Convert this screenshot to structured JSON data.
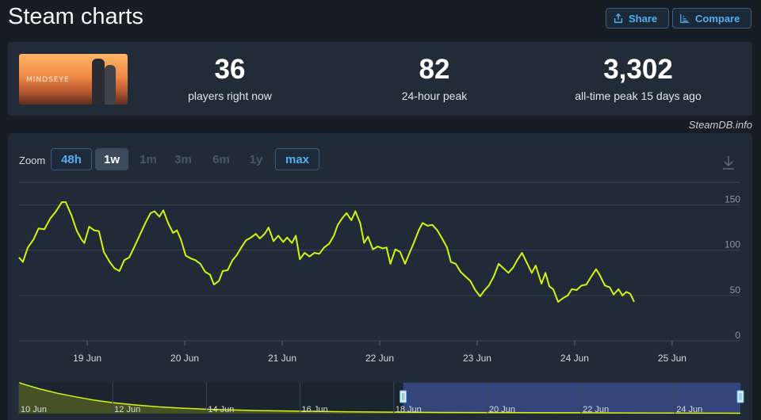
{
  "header": {
    "title": "Steam charts",
    "share_label": "Share",
    "compare_label": "Compare"
  },
  "game": {
    "logo_text": "MINDSEYE"
  },
  "stats": [
    {
      "value": "36",
      "label": "players right now"
    },
    {
      "value": "82",
      "label": "24-hour peak"
    },
    {
      "value": "3,302",
      "label": "all-time peak 15 days ago"
    }
  ],
  "credit": "SteamDB.info",
  "zoom": {
    "label": "Zoom",
    "options": [
      "48h",
      "1w",
      "1m",
      "3m",
      "6m",
      "1y",
      "max"
    ],
    "active": "1w"
  },
  "colors": {
    "line": "#d4f30f",
    "accent": "#4fb0f0",
    "navigator_selection": "#34457c"
  },
  "chart_data": {
    "type": "line",
    "title": "",
    "ylim": [
      0,
      175
    ],
    "yticks": [
      0,
      50,
      100,
      150
    ],
    "xlim": [
      18.3,
      25.7
    ],
    "xtick_labels": [
      "19 Jun",
      "20 Jun",
      "21 Jun",
      "22 Jun",
      "23 Jun",
      "24 Jun",
      "25 Jun"
    ],
    "xtick_values": [
      19,
      20,
      21,
      22,
      23,
      24,
      25
    ],
    "series": [
      {
        "values": [
          [
            18.3,
            92
          ],
          [
            18.34,
            87
          ],
          [
            18.39,
            103
          ],
          [
            18.45,
            112
          ],
          [
            18.5,
            124
          ],
          [
            18.56,
            123
          ],
          [
            18.62,
            135
          ],
          [
            18.68,
            143
          ],
          [
            18.74,
            153
          ],
          [
            18.78,
            153
          ],
          [
            18.84,
            138
          ],
          [
            18.89,
            122
          ],
          [
            18.94,
            112
          ],
          [
            18.97,
            108
          ],
          [
            19.02,
            126
          ],
          [
            19.07,
            122
          ],
          [
            19.12,
            121
          ],
          [
            19.17,
            98
          ],
          [
            19.23,
            87
          ],
          [
            19.28,
            80
          ],
          [
            19.33,
            77
          ],
          [
            19.38,
            89
          ],
          [
            19.43,
            92
          ],
          [
            19.48,
            103
          ],
          [
            19.54,
            117
          ],
          [
            19.6,
            131
          ],
          [
            19.65,
            141
          ],
          [
            19.69,
            143
          ],
          [
            19.74,
            137
          ],
          [
            19.78,
            144
          ],
          [
            19.83,
            130
          ],
          [
            19.88,
            119
          ],
          [
            19.92,
            122
          ],
          [
            19.96,
            112
          ],
          [
            20.01,
            94
          ],
          [
            20.06,
            91
          ],
          [
            20.11,
            89
          ],
          [
            20.16,
            85
          ],
          [
            20.21,
            76
          ],
          [
            20.26,
            73
          ],
          [
            20.3,
            62
          ],
          [
            20.35,
            66
          ],
          [
            20.39,
            77
          ],
          [
            20.44,
            78
          ],
          [
            20.49,
            89
          ],
          [
            20.53,
            94
          ],
          [
            20.58,
            103
          ],
          [
            20.63,
            111
          ],
          [
            20.68,
            114
          ],
          [
            20.73,
            118
          ],
          [
            20.77,
            113
          ],
          [
            20.82,
            118
          ],
          [
            20.86,
            125
          ],
          [
            20.91,
            110
          ],
          [
            20.96,
            116
          ],
          [
            21.01,
            109
          ],
          [
            21.05,
            114
          ],
          [
            21.1,
            108
          ],
          [
            21.14,
            116
          ],
          [
            21.18,
            90
          ],
          [
            21.23,
            97
          ],
          [
            21.28,
            93
          ],
          [
            21.33,
            97
          ],
          [
            21.38,
            96
          ],
          [
            21.43,
            103
          ],
          [
            21.48,
            107
          ],
          [
            21.53,
            116
          ],
          [
            21.57,
            128
          ],
          [
            21.62,
            136
          ],
          [
            21.66,
            141
          ],
          [
            21.71,
            133
          ],
          [
            21.75,
            143
          ],
          [
            21.8,
            130
          ],
          [
            21.84,
            108
          ],
          [
            21.88,
            115
          ],
          [
            21.93,
            101
          ],
          [
            21.98,
            104
          ],
          [
            22.03,
            102
          ],
          [
            22.07,
            103
          ],
          [
            22.11,
            85
          ],
          [
            22.16,
            101
          ],
          [
            22.21,
            98
          ],
          [
            22.26,
            85
          ],
          [
            22.31,
            98
          ],
          [
            22.35,
            108
          ],
          [
            22.4,
            122
          ],
          [
            22.44,
            130
          ],
          [
            22.49,
            127
          ],
          [
            22.54,
            128
          ],
          [
            22.59,
            122
          ],
          [
            22.64,
            113
          ],
          [
            22.69,
            103
          ],
          [
            22.73,
            87
          ],
          [
            22.78,
            85
          ],
          [
            22.83,
            76
          ],
          [
            22.88,
            71
          ],
          [
            22.93,
            66
          ],
          [
            22.98,
            56
          ],
          [
            23.03,
            49
          ],
          [
            23.07,
            55
          ],
          [
            23.12,
            61
          ],
          [
            23.17,
            71
          ],
          [
            23.22,
            85
          ],
          [
            23.27,
            80
          ],
          [
            23.32,
            75
          ],
          [
            23.37,
            81
          ],
          [
            23.41,
            89
          ],
          [
            23.46,
            97
          ],
          [
            23.51,
            86
          ],
          [
            23.56,
            75
          ],
          [
            23.6,
            83
          ],
          [
            23.66,
            63
          ],
          [
            23.7,
            75
          ],
          [
            23.74,
            60
          ],
          [
            23.78,
            57
          ],
          [
            23.83,
            43
          ],
          [
            23.88,
            47
          ],
          [
            23.93,
            50
          ],
          [
            23.97,
            57
          ],
          [
            24.02,
            56
          ],
          [
            24.07,
            61
          ],
          [
            24.12,
            62
          ],
          [
            24.17,
            71
          ],
          [
            24.22,
            79
          ],
          [
            24.26,
            72
          ],
          [
            24.31,
            61
          ],
          [
            24.36,
            59
          ],
          [
            24.4,
            51
          ],
          [
            24.45,
            57
          ],
          [
            24.49,
            50
          ],
          [
            24.53,
            54
          ],
          [
            24.57,
            52
          ],
          [
            24.61,
            43
          ]
        ]
      }
    ],
    "navigator": {
      "xtick_labels": [
        "10 Jun",
        "12 Jun",
        "14 Jun",
        "16 Jun",
        "18 Jun",
        "20 Jun",
        "22 Jun",
        "24 Jun"
      ],
      "xtick_values": [
        10,
        12,
        14,
        16,
        18,
        20,
        22,
        24
      ],
      "xlim": [
        10,
        25.4
      ],
      "selection": [
        18.2,
        25.4
      ],
      "ylim": [
        0,
        3302
      ],
      "values": [
        [
          10,
          3302
        ],
        [
          10.4,
          2700
        ],
        [
          10.8,
          2200
        ],
        [
          11.2,
          1800
        ],
        [
          11.6,
          1450
        ],
        [
          12,
          1180
        ],
        [
          12.5,
          920
        ],
        [
          13,
          720
        ],
        [
          13.5,
          580
        ],
        [
          14,
          470
        ],
        [
          15,
          340
        ],
        [
          16,
          260
        ],
        [
          17,
          200
        ],
        [
          18,
          160
        ],
        [
          19,
          130
        ],
        [
          20,
          115
        ],
        [
          21,
          105
        ],
        [
          22,
          95
        ],
        [
          23,
          80
        ],
        [
          24,
          65
        ],
        [
          25,
          55
        ],
        [
          25.4,
          45
        ]
      ]
    }
  }
}
